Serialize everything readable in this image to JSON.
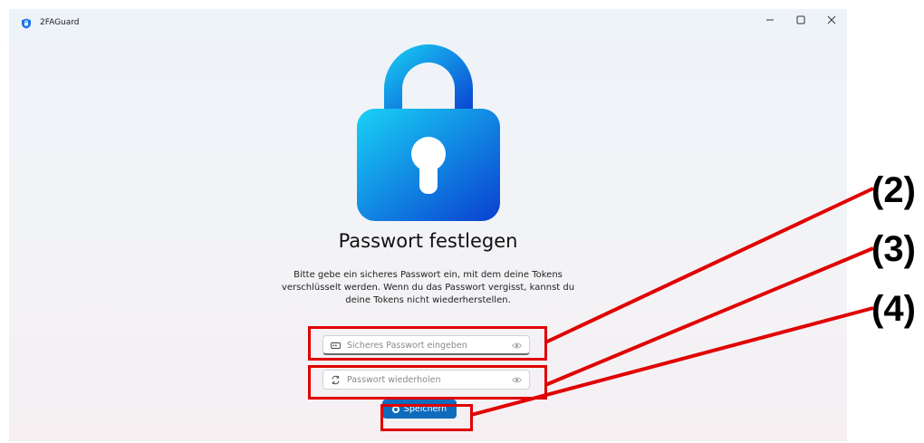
{
  "window": {
    "title": "2FAGuard",
    "controls": [
      "minimize-icon",
      "maximize-icon",
      "close-icon"
    ]
  },
  "main": {
    "icon": "lock-icon",
    "heading": "Passwort festlegen",
    "description": "Bitte gebe ein sicheres Passwort ein, mit dem deine Tokens verschlüsselt werden. Wenn du das Passwort vergisst, kannst du deine Tokens nicht wiederherstellen.",
    "password_field": {
      "placeholder": "Sicheres Passwort eingeben",
      "value": "",
      "icon": "password-icon"
    },
    "repeat_field": {
      "placeholder": "Passwort wiederholen",
      "value": "",
      "icon": "repeat-icon"
    },
    "save_label": "Speichern"
  },
  "annotations": {
    "label_2": "(2)",
    "label_3": "(3)",
    "label_4": "(4)",
    "color": "#e00000"
  },
  "colors": {
    "accent": "#0f6cbd",
    "lock_gradient_start": "#19d2f5",
    "lock_gradient_end": "#0a3fd0"
  }
}
